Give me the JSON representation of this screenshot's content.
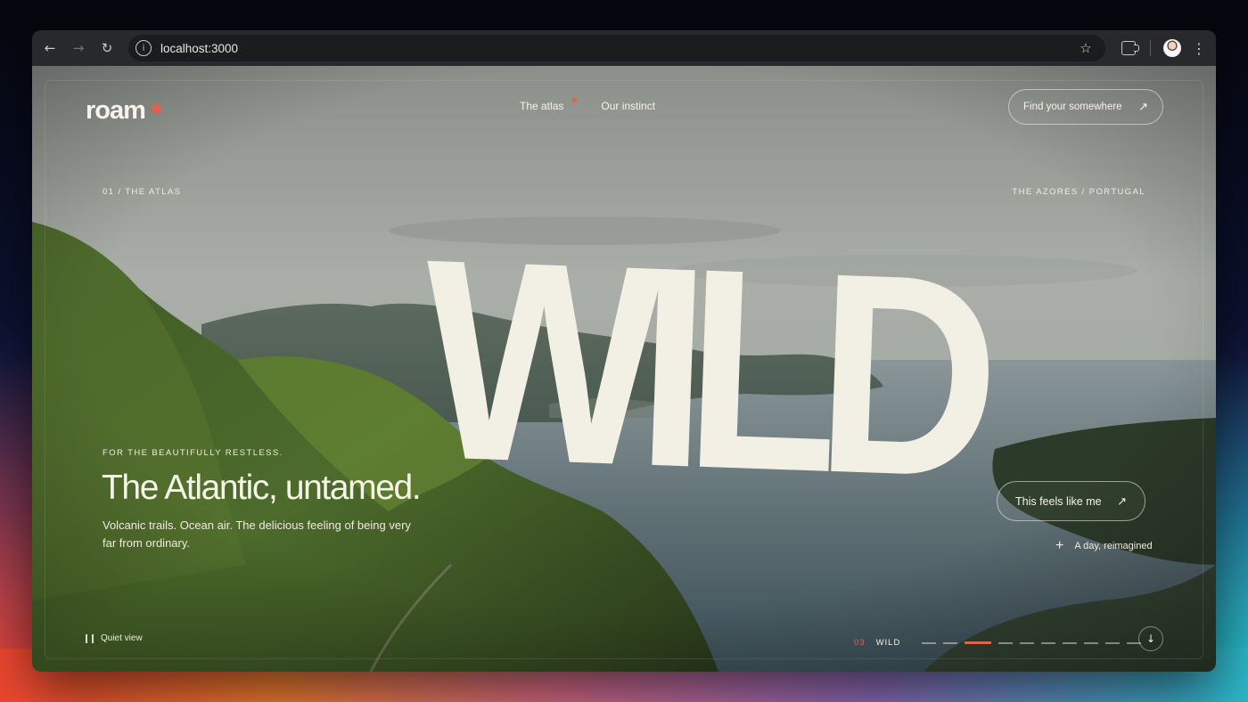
{
  "browser": {
    "url": "localhost:3000",
    "icons": [
      "back-icon",
      "forward-icon",
      "reload-icon",
      "info-icon",
      "star-icon",
      "extensions-icon",
      "profile-avatar",
      "menu-icon"
    ]
  },
  "site": {
    "logo": "roam",
    "nav": [
      {
        "label": "The atlas",
        "active": true
      },
      {
        "label": "Our instinct",
        "active": false
      }
    ],
    "cta_top": "Find your somewhere",
    "section_label": "01 / THE ATLAS",
    "location_label": "THE AZORES / PORTUGAL",
    "tagline": "FOR THE BEAUTIFULLY RESTLESS.",
    "headline": "The Atlantic, untamed.",
    "subcopy": "Volcanic trails. Ocean air. The delicious feeling of being very far from ordinary.",
    "big_word": "WILD",
    "cta_mid": "This feels like me",
    "secondary_link": "A day, reimagined",
    "quiet_view": "Quiet view",
    "slide_number": "03",
    "slide_name": "WILD",
    "slide_count": 10,
    "active_slide_index": 2
  },
  "colors": {
    "accent": "#e0644b",
    "text": "#f6f3ea",
    "browser_chrome": "#28292c"
  }
}
